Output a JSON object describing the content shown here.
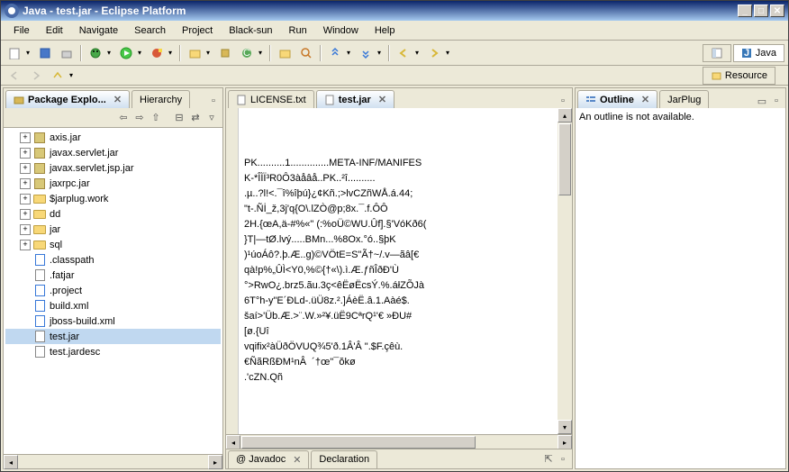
{
  "window": {
    "title": "Java - test.jar - Eclipse Platform"
  },
  "menu": {
    "items": [
      "File",
      "Edit",
      "Navigate",
      "Search",
      "Project",
      "Black-sun",
      "Run",
      "Window",
      "Help"
    ]
  },
  "perspectives": {
    "java": "Java",
    "resource": "Resource"
  },
  "packageExplorer": {
    "title": "Package Explo...",
    "hierarchyTab": "Hierarchy",
    "items": [
      {
        "label": "axis.jar",
        "icon": "jar",
        "depth": 1,
        "expand": "+"
      },
      {
        "label": "javax.servlet.jar",
        "icon": "jar",
        "depth": 1,
        "expand": "+"
      },
      {
        "label": "javax.servlet.jsp.jar",
        "icon": "jar",
        "depth": 1,
        "expand": "+"
      },
      {
        "label": "jaxrpc.jar",
        "icon": "jar",
        "depth": 1,
        "expand": "+"
      },
      {
        "label": "$jarplug.work",
        "icon": "folder",
        "depth": 1,
        "expand": "+"
      },
      {
        "label": "dd",
        "icon": "folder",
        "depth": 1,
        "expand": "+"
      },
      {
        "label": "jar",
        "icon": "folder",
        "depth": 1,
        "expand": "+"
      },
      {
        "label": "sql",
        "icon": "folder",
        "depth": 1,
        "expand": "+"
      },
      {
        "label": ".classpath",
        "icon": "xml",
        "depth": 1,
        "expand": ""
      },
      {
        "label": ".fatjar",
        "icon": "file",
        "depth": 1,
        "expand": ""
      },
      {
        "label": ".project",
        "icon": "xml",
        "depth": 1,
        "expand": ""
      },
      {
        "label": "build.xml",
        "icon": "xml",
        "depth": 1,
        "expand": ""
      },
      {
        "label": "jboss-build.xml",
        "icon": "xml",
        "depth": 1,
        "expand": ""
      },
      {
        "label": "test.jar",
        "icon": "file",
        "depth": 1,
        "expand": "",
        "selected": true
      },
      {
        "label": "test.jardesc",
        "icon": "file",
        "depth": 1,
        "expand": ""
      }
    ]
  },
  "editor": {
    "tabs": [
      {
        "label": "LICENSE.txt",
        "active": false
      },
      {
        "label": "test.jar",
        "active": true
      }
    ],
    "content": "PK..........1..............META-INF/MANIFES\nK-*ÎÌÏ³R0Ô3àåâå..PK..²î..........\n.µ..?l!<.¯î%îþú}¿¢Kñ.;>lvCZñWÅ.á.44;\n\"t-.Ñİ_ž,3j'q{O\\.lZÒ@p;8x.¯.f.ÔÔ\n2H.{œA,ä-#%«\" (:%oÜ©WU.Ûf].§'VóKð6(\n}T|—tØ.lvý.....BMn...%8Ox.°ó..§þK\n)¹úoÁô?.þ.Æ..g)©VÖtE=S\"Ã†~/.v—ãâ[€\nqà!p%„ÛÌ<Y0,%©{†«\\).ì.Æ.ƒñÎðĐ'Ù\n°>RwO¿.brz5.ãu.3ç<êËøËcsÝ.%.áłZÕJà\n6T°h-y\"E´ÐLd-.üÜ8z.².]ÁèË.â.1.Aàé$.\nšaí>'Üb.Æ.>¨.W.»²¥.üË9CªrQ¹'€ »ÐU#\n[ø.{Uî\nvqifix²àÜðÖVUQ¾5'ð.1Â'Â \".$F.çêù.\n€ÑãRßÐМ¹nÂ  ´†œ\"¯ŏkø\n.'cZN.Qñ"
  },
  "outline": {
    "title": "Outline",
    "jarplugTab": "JarPlug",
    "message": "An outline is not available."
  },
  "bottomTabs": {
    "javadoc": "@ Javadoc",
    "declaration": "Declaration"
  }
}
